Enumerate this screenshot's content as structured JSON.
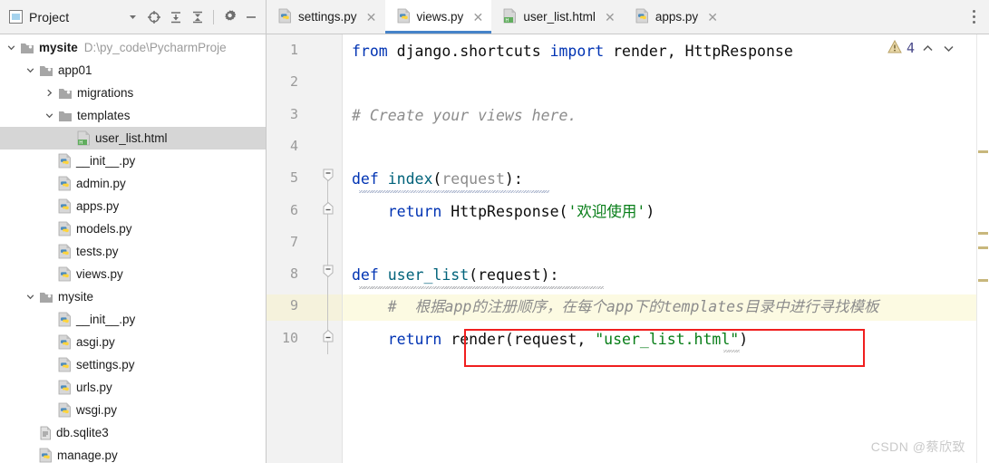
{
  "window": {
    "watermark": "CSDN @蔡欣致"
  },
  "project_panel": {
    "title": "Project",
    "icons": [
      {
        "name": "chevron-down-icon",
        "glyph": "▾"
      },
      {
        "name": "locate-target-icon",
        "glyph": "⊕"
      },
      {
        "name": "expand-all-icon",
        "glyph": "⤓"
      },
      {
        "name": "collapse-all-icon",
        "glyph": "⤒"
      },
      {
        "name": "settings-gear-icon",
        "glyph": "⚙"
      },
      {
        "name": "hide-panel-icon",
        "glyph": "—"
      }
    ],
    "tree": [
      {
        "label": "mysite",
        "path": "D:\\py_code\\PycharmProje",
        "indent": 0,
        "arrow": "down",
        "icon": "folder-project",
        "bold": true,
        "selected": false
      },
      {
        "label": "app01",
        "path": "",
        "indent": 1,
        "arrow": "down",
        "icon": "folder-module",
        "bold": false,
        "selected": false
      },
      {
        "label": "migrations",
        "path": "",
        "indent": 2,
        "arrow": "right",
        "icon": "folder-module",
        "bold": false,
        "selected": false
      },
      {
        "label": "templates",
        "path": "",
        "indent": 2,
        "arrow": "down",
        "icon": "folder",
        "bold": false,
        "selected": false
      },
      {
        "label": "user_list.html",
        "path": "",
        "indent": 3,
        "arrow": "none",
        "icon": "html",
        "bold": false,
        "selected": true
      },
      {
        "label": "__init__.py",
        "path": "",
        "indent": 2,
        "arrow": "none",
        "icon": "python",
        "bold": false,
        "selected": false
      },
      {
        "label": "admin.py",
        "path": "",
        "indent": 2,
        "arrow": "none",
        "icon": "python",
        "bold": false,
        "selected": false
      },
      {
        "label": "apps.py",
        "path": "",
        "indent": 2,
        "arrow": "none",
        "icon": "python",
        "bold": false,
        "selected": false
      },
      {
        "label": "models.py",
        "path": "",
        "indent": 2,
        "arrow": "none",
        "icon": "python",
        "bold": false,
        "selected": false
      },
      {
        "label": "tests.py",
        "path": "",
        "indent": 2,
        "arrow": "none",
        "icon": "python",
        "bold": false,
        "selected": false
      },
      {
        "label": "views.py",
        "path": "",
        "indent": 2,
        "arrow": "none",
        "icon": "python",
        "bold": false,
        "selected": false
      },
      {
        "label": "mysite",
        "path": "",
        "indent": 1,
        "arrow": "down",
        "icon": "folder-module",
        "bold": false,
        "selected": false
      },
      {
        "label": "__init__.py",
        "path": "",
        "indent": 2,
        "arrow": "none",
        "icon": "python",
        "bold": false,
        "selected": false
      },
      {
        "label": "asgi.py",
        "path": "",
        "indent": 2,
        "arrow": "none",
        "icon": "python",
        "bold": false,
        "selected": false
      },
      {
        "label": "settings.py",
        "path": "",
        "indent": 2,
        "arrow": "none",
        "icon": "python",
        "bold": false,
        "selected": false
      },
      {
        "label": "urls.py",
        "path": "",
        "indent": 2,
        "arrow": "none",
        "icon": "python",
        "bold": false,
        "selected": false
      },
      {
        "label": "wsgi.py",
        "path": "",
        "indent": 2,
        "arrow": "none",
        "icon": "python",
        "bold": false,
        "selected": false
      },
      {
        "label": "db.sqlite3",
        "path": "",
        "indent": 1,
        "arrow": "none",
        "icon": "file",
        "bold": false,
        "selected": false
      },
      {
        "label": "manage.py",
        "path": "",
        "indent": 1,
        "arrow": "none",
        "icon": "python",
        "bold": false,
        "selected": false
      }
    ]
  },
  "tabs": [
    {
      "label": "settings.py",
      "icon": "python",
      "active": false,
      "close": "✕"
    },
    {
      "label": "views.py",
      "icon": "python",
      "active": true,
      "close": "✕"
    },
    {
      "label": "user_list.html",
      "icon": "html",
      "active": false,
      "close": "✕"
    },
    {
      "label": "apps.py",
      "icon": "python",
      "active": false,
      "close": "✕"
    }
  ],
  "editor": {
    "line_numbers": [
      "1",
      "2",
      "3",
      "4",
      "5",
      "6",
      "7",
      "8",
      "9",
      "10"
    ],
    "caret_line": 9,
    "lines": [
      {
        "n": "1",
        "tokens": [
          {
            "t": "from",
            "c": "kw"
          },
          {
            "t": " django.shortcuts ",
            "c": "pl"
          },
          {
            "t": "import",
            "c": "kw"
          },
          {
            "t": " render, HttpResponse",
            "c": "pl"
          }
        ]
      },
      {
        "n": "2",
        "tokens": []
      },
      {
        "n": "3",
        "tokens": [
          {
            "t": "# Create your views here.",
            "c": "cmt"
          }
        ]
      },
      {
        "n": "4",
        "tokens": []
      },
      {
        "n": "5",
        "tokens": [
          {
            "t": "def",
            "c": "kw"
          },
          {
            "t": " ",
            "c": "pl"
          },
          {
            "t": "index",
            "c": "fn"
          },
          {
            "t": "(",
            "c": "pl"
          },
          {
            "t": "request",
            "c": "par"
          },
          {
            "t": "):",
            "c": "pl"
          }
        ]
      },
      {
        "n": "6",
        "tokens": [
          {
            "t": "    ",
            "c": "pl"
          },
          {
            "t": "return",
            "c": "kw"
          },
          {
            "t": " HttpResponse(",
            "c": "pl"
          },
          {
            "t": "'欢迎使用'",
            "c": "str"
          },
          {
            "t": ")",
            "c": "pl"
          }
        ]
      },
      {
        "n": "7",
        "tokens": []
      },
      {
        "n": "8",
        "tokens": [
          {
            "t": "def",
            "c": "kw"
          },
          {
            "t": " ",
            "c": "pl"
          },
          {
            "t": "user_list",
            "c": "fn"
          },
          {
            "t": "(request):",
            "c": "pl"
          }
        ]
      },
      {
        "n": "9",
        "tokens": [
          {
            "t": "    #  根据app的注册顺序，在每个app下的templates目录中进行寻找模板",
            "c": "cmt"
          }
        ]
      },
      {
        "n": "10",
        "tokens": [
          {
            "t": "    ",
            "c": "pl"
          },
          {
            "t": "return",
            "c": "kw"
          },
          {
            "t": " render(request, ",
            "c": "pl"
          },
          {
            "t": "\"user_list.html\"",
            "c": "str"
          },
          {
            "t": ")",
            "c": "pl"
          }
        ]
      }
    ],
    "inspection": {
      "warning_count": "4",
      "warning_icon": "warning-triangle-icon",
      "prev_glyph": "⌃",
      "next_glyph": "⌄"
    }
  },
  "colors": {
    "accent_tab": "#4683c9",
    "keyword": "#0033b3",
    "string": "#067d17",
    "comment": "#8c8c8c",
    "function": "#00627a",
    "highlight_box": "#f01f1f",
    "caret_line_bg": "#fcfae2",
    "selection_bg": "#d6d6d6",
    "marker": "#c8b77c"
  }
}
